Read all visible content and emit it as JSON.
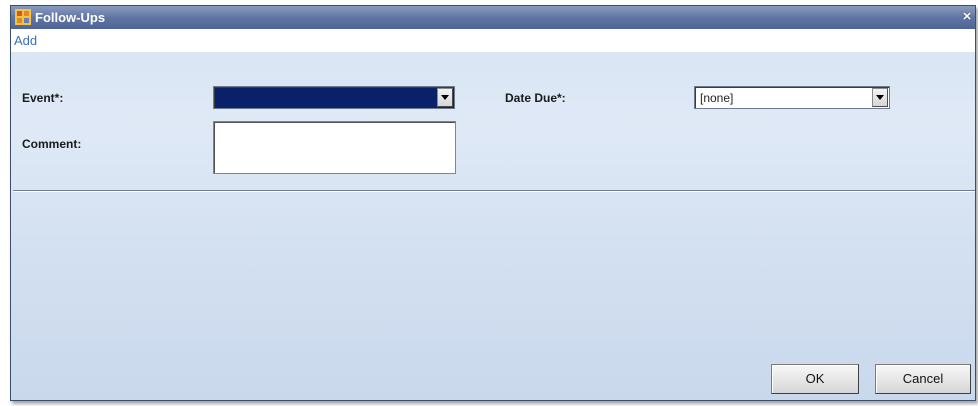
{
  "window": {
    "title": "Follow-Ups",
    "close_glyph": "×",
    "icon": "app-icon"
  },
  "menu": {
    "items": [
      {
        "label": "Add"
      }
    ]
  },
  "form": {
    "event": {
      "label": "Event*:",
      "value": "",
      "selected_highlight": "#0a2169"
    },
    "date_due": {
      "label": "Date Due*:",
      "value": "[none]"
    },
    "comment": {
      "label": "Comment:",
      "value": ""
    }
  },
  "buttons": {
    "ok": "OK",
    "cancel": "Cancel"
  },
  "colors": {
    "titlebar": "#5f76a4",
    "menu_text": "#3c6fb8",
    "body_gradient_top": "#dfe9f6",
    "body_gradient_bottom": "#c9d8ec"
  }
}
